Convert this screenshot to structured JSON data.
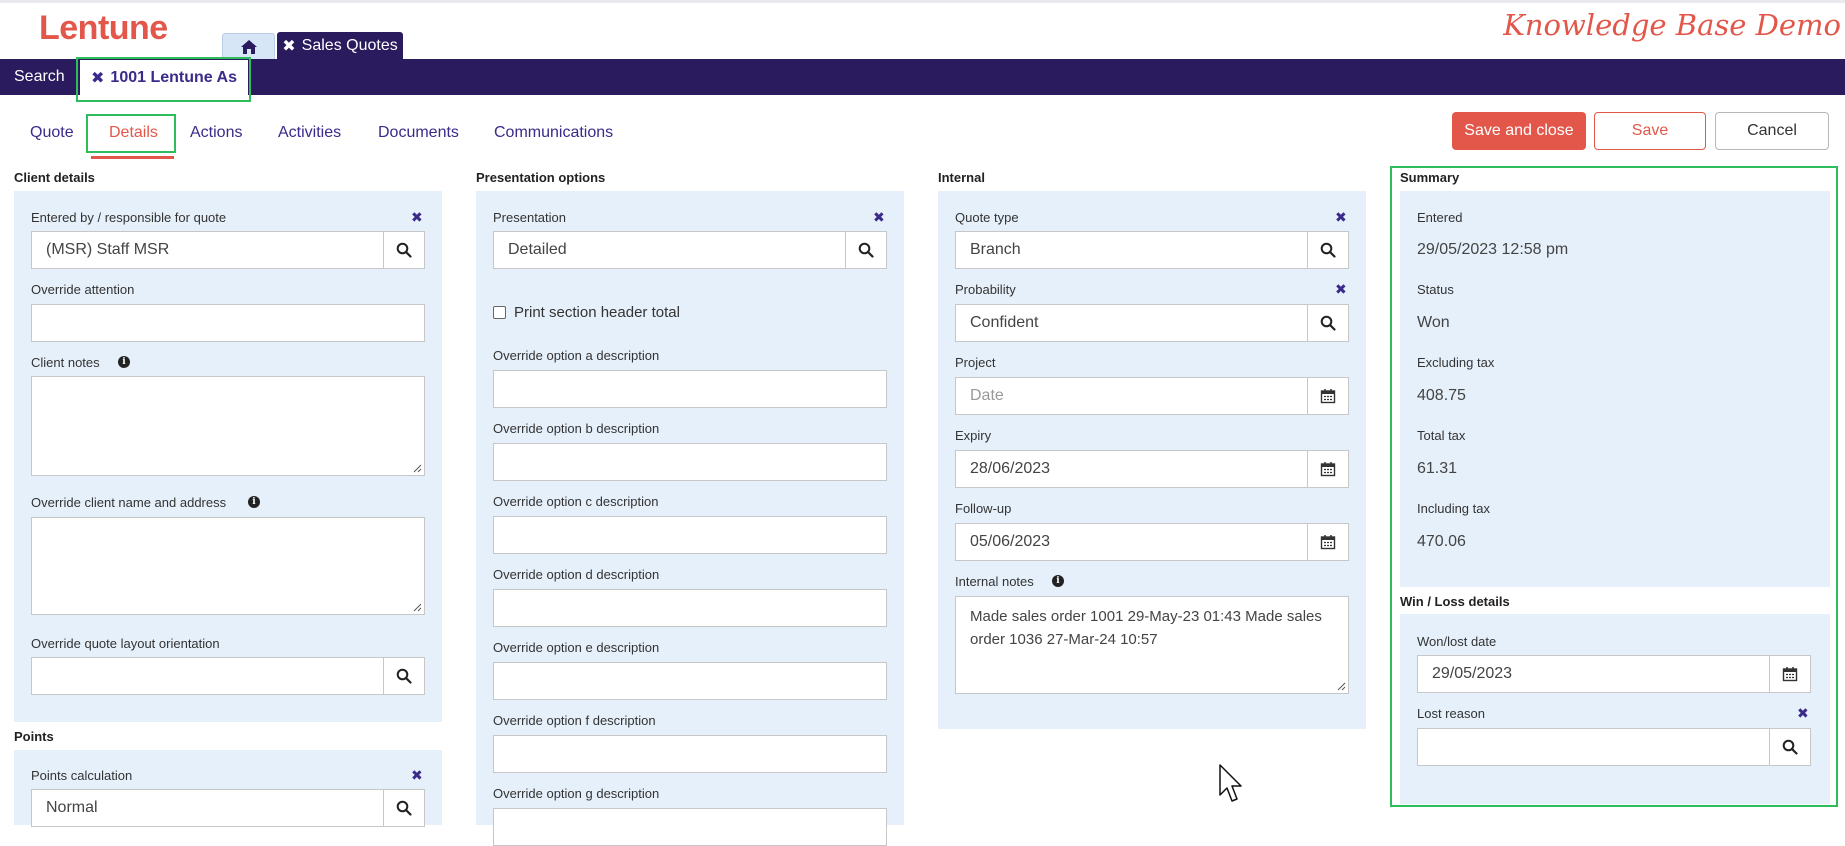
{
  "app": {
    "logo": "Lentune",
    "kb_title": "Knowledge Base Demo"
  },
  "top_tabs": {
    "sales_quotes": "Sales Quotes"
  },
  "nav": {
    "search": "Search",
    "record_tab": "1001 Lentune As"
  },
  "tabs": [
    "Quote",
    "Details",
    "Actions",
    "Activities",
    "Documents",
    "Communications"
  ],
  "actions": {
    "save_close": "Save and close",
    "save": "Save",
    "cancel": "Cancel"
  },
  "client_details": {
    "title": "Client details",
    "entered_by_label": "Entered by / responsible for quote",
    "entered_by_value": "(MSR) Staff MSR",
    "override_attention_label": "Override attention",
    "client_notes_label": "Client notes",
    "override_name_label": "Override client name and address",
    "layout_label": "Override quote layout orientation"
  },
  "points": {
    "title": "Points",
    "calc_label": "Points calculation",
    "calc_value": "Normal"
  },
  "presentation": {
    "title": "Presentation options",
    "presentation_label": "Presentation",
    "presentation_value": "Detailed",
    "print_header_label": "Print section header total",
    "opt_a": "Override option a description",
    "opt_b": "Override option b description",
    "opt_c": "Override option c description",
    "opt_d": "Override option d description",
    "opt_e": "Override option e description",
    "opt_f": "Override option f description",
    "opt_g": "Override option g description"
  },
  "internal": {
    "title": "Internal",
    "quote_type_label": "Quote type",
    "quote_type_value": "Branch",
    "probability_label": "Probability",
    "probability_value": "Confident",
    "project_label": "Project",
    "project_placeholder": "Date",
    "expiry_label": "Expiry",
    "expiry_value": "28/06/2023",
    "followup_label": "Follow-up",
    "followup_value": "05/06/2023",
    "notes_label": "Internal notes",
    "notes_value": "Made sales order 1001 29-May-23 01:43 Made sales order 1036 27-Mar-24 10:57"
  },
  "summary": {
    "title": "Summary",
    "entered_label": "Entered",
    "entered_value": "29/05/2023 12:58 pm",
    "status_label": "Status",
    "status_value": "Won",
    "excl_label": "Excluding tax",
    "excl_value": "408.75",
    "tax_label": "Total tax",
    "tax_value": "61.31",
    "incl_label": "Including tax",
    "incl_value": "470.06"
  },
  "winloss": {
    "title": "Win / Loss details",
    "date_label": "Won/lost date",
    "date_value": "29/05/2023",
    "reason_label": "Lost reason"
  },
  "colors": {
    "brand": "#e3574a",
    "nav": "#2a1a5e",
    "panel": "#e6f0fb",
    "highlight": "#2ebd5a"
  }
}
